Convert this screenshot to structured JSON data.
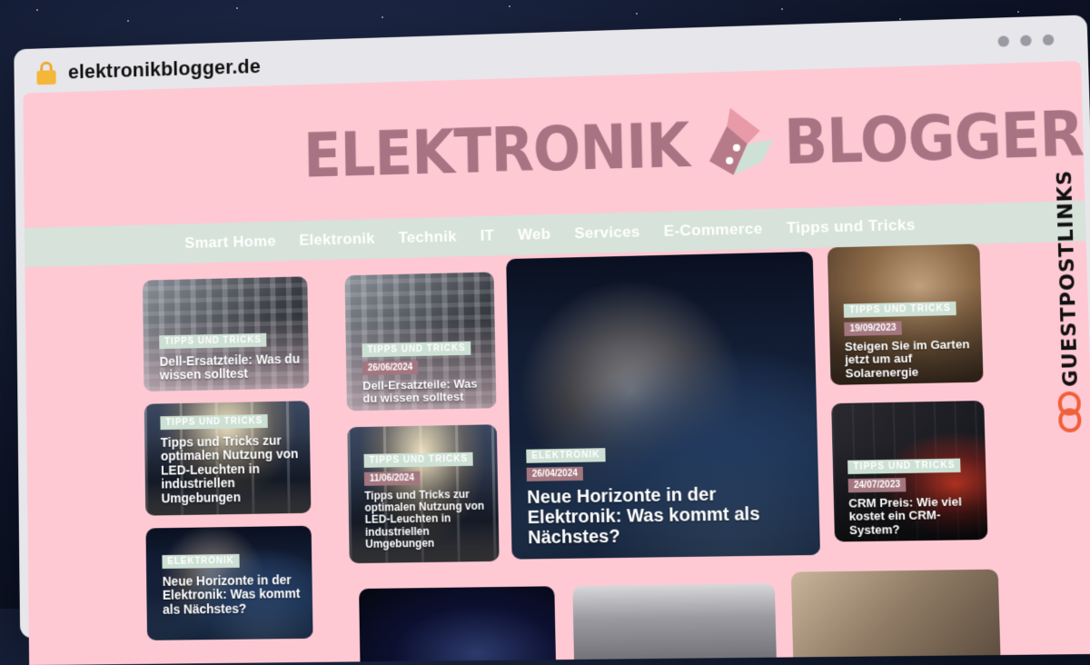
{
  "browser": {
    "url": "elektronikblogger.de"
  },
  "site": {
    "logo_left": "ELEKTRONIK",
    "logo_right": "BLOGGER"
  },
  "nav": [
    "Smart Home",
    "Elektronik",
    "Technik",
    "IT",
    "Web",
    "Services",
    "E-Commerce",
    "Tipps und Tricks"
  ],
  "posts": [
    {
      "tag": "TIPPS UND TRICKS",
      "date": "",
      "title": "Dell-Ersatzteile: Was du wissen solltest"
    },
    {
      "tag": "TIPPS UND TRICKS",
      "date": "",
      "title": "Tipps und Tricks zur optimalen Nutzung von LED-Leuchten in industriellen Umgebungen"
    },
    {
      "tag": "ELEKTRONIK",
      "date": "",
      "title": "Neue Horizonte in der Elektronik: Was kommt als Nächstes?"
    },
    {
      "tag": "TIPPS UND TRICKS",
      "date": "26/06/2024",
      "title": "Dell-Ersatzteile: Was du wissen solltest"
    },
    {
      "tag": "TIPPS UND TRICKS",
      "date": "11/06/2024",
      "title": "Tipps und Tricks zur optimalen Nutzung von LED-Leuchten in industriellen Umgebungen"
    },
    {
      "tag": "ELEKTRONIK",
      "date": "26/04/2024",
      "title": "Neue Horizonte in der Elektronik: Was kommt als Nächstes?"
    },
    {
      "tag": "TIPPS UND TRICKS",
      "date": "19/09/2023",
      "title": "Steigen Sie im Garten jetzt um auf Solarenergie"
    },
    {
      "tag": "TIPPS UND TRICKS",
      "date": "24/07/2023",
      "title": "CRM Preis: Wie viel kostet ein CRM-System?"
    }
  ],
  "banner": {
    "text": "GUESTPOSTLINKS"
  },
  "colors": {
    "page_bg": "#ffc9d4",
    "nav_bg": "#d6e2da",
    "logo": "#a87383",
    "tag_bg": "#cde0d4",
    "date_bg": "#a4767f",
    "banner_accent": "#f0603a"
  }
}
